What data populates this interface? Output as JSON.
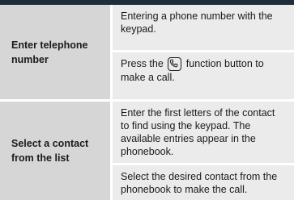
{
  "rows": [
    {
      "label": "Enter telephone number",
      "steps": [
        {
          "text": "Entering a phone number with the keypad."
        },
        {
          "before": "Press the",
          "icon": "phone-function-icon",
          "after": "function button to make a call."
        }
      ]
    },
    {
      "label": "Select a contact from the list",
      "steps": [
        {
          "text": "Enter the first letters of the contact to find using the keypad. The available entries appear in the phonebook."
        },
        {
          "text": "Select the desired contact from the phonebook to make the call."
        }
      ]
    }
  ],
  "colors": {
    "header": "#1e2d3c",
    "label_bg": "#d6d6d6",
    "cell_bg": "#ebebeb"
  }
}
